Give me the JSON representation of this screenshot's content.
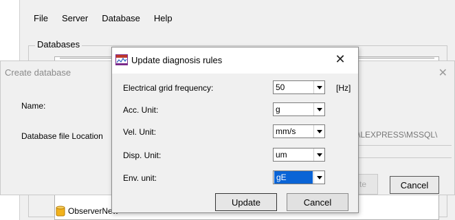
{
  "main_window": {
    "menu": [
      "File",
      "Server",
      "Database",
      "Help"
    ],
    "group_label": "Databases",
    "list_items": [
      {
        "label": "ObserverNew",
        "icon": "database-icon"
      }
    ]
  },
  "create_database": {
    "title": "Create database",
    "name_label": "Name:",
    "location_label": "Database file Location",
    "path_fragment": "\\LEXPRESS\\MSSQL\\",
    "partial_button": "te",
    "cancel_label": "Cancel"
  },
  "dialog": {
    "title": "Update diagnosis rules",
    "rows": [
      {
        "label": "Electrical grid frequency:",
        "value": "50",
        "unit": "[Hz]"
      },
      {
        "label": "Acc. Unit:",
        "value": "g"
      },
      {
        "label": "Vel. Unit:",
        "value": "mm/s"
      },
      {
        "label": "Disp. Unit:",
        "value": "um"
      },
      {
        "label": "Env. unit:",
        "value": "gE",
        "selected": true
      }
    ],
    "update_label": "Update",
    "cancel_label": "Cancel"
  },
  "colors": {
    "selection": "#0a64d6",
    "window_bg": "#f0f0f0"
  }
}
